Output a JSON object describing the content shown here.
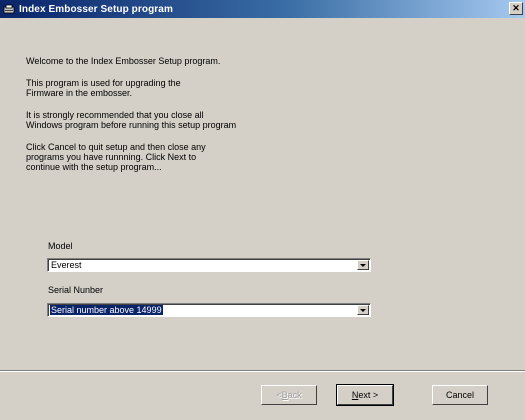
{
  "window": {
    "title": "Index Embosser Setup program",
    "close_glyph": "✕",
    "icon": "setup-icon"
  },
  "intro": {
    "p1": "Welcome to the Index Embosser Setup program.",
    "p2": "This program is used for upgrading the\nFirmware in the embosser.",
    "p3": "It is strongly recommended that you close all\nWindows program before running this setup program",
    "p4": "Click Cancel to quit setup and then close any\nprograms you have runnning. Click Next to\ncontinue with the setup program..."
  },
  "model": {
    "label": "Model",
    "selected": "Everest"
  },
  "serial": {
    "label": "Serial Nunber",
    "selected": "Serial number above 14999"
  },
  "buttons": {
    "back_prefix": "< ",
    "back_mnemonic": "B",
    "back_rest": "ack",
    "next_mnemonic": "N",
    "next_rest": "ext >",
    "cancel": "Cancel"
  },
  "colors": {
    "title_start": "#0a246a",
    "title_end": "#a6caf0",
    "face": "#d4d0c8",
    "selection": "#0a246a"
  }
}
